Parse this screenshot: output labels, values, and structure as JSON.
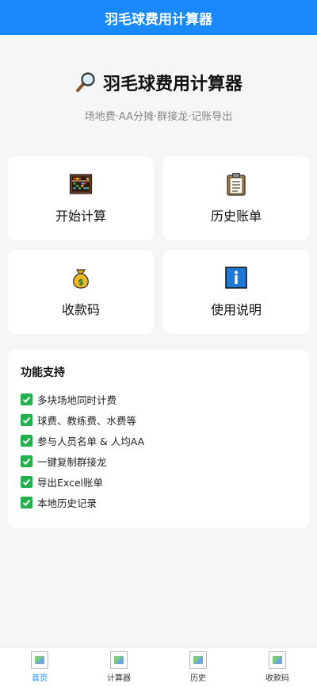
{
  "nav": {
    "title": "羽毛球费用计算器"
  },
  "hero": {
    "title": "羽毛球费用计算器",
    "subtitle": "场地费·AA分摊·群接龙·记账导出"
  },
  "menu": [
    {
      "label": "开始计算",
      "icon": "abacus-icon"
    },
    {
      "label": "历史账单",
      "icon": "clipboard-icon"
    },
    {
      "label": "收款码",
      "icon": "money-bag-icon"
    },
    {
      "label": "使用说明",
      "icon": "info-icon"
    }
  ],
  "features": {
    "title": "功能支持",
    "items": [
      "多块场地同时计费",
      "球费、教练费、水费等",
      "参与人员名单 & 人均AA",
      "一键复制群接龙",
      "导出Excel账单",
      "本地历史记录"
    ]
  },
  "tabbar": [
    {
      "label": "首页",
      "active": true
    },
    {
      "label": "计算器",
      "active": false
    },
    {
      "label": "历史",
      "active": false
    },
    {
      "label": "收款码",
      "active": false
    }
  ],
  "colors": {
    "primary": "#1989fa",
    "check": "#22b14c",
    "background": "#f5f6f8"
  }
}
